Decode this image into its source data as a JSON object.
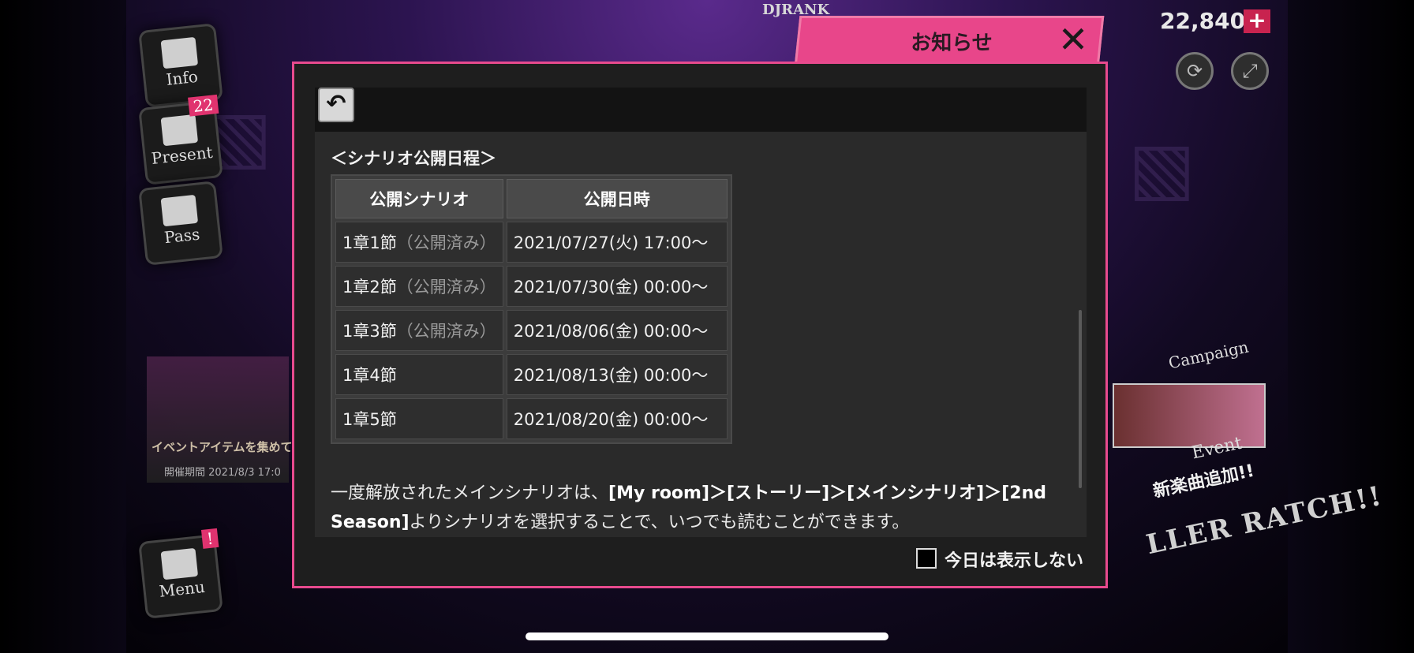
{
  "background": {
    "djrank_label": "DJRANK",
    "currency_amount": "22,840",
    "side_buttons": [
      {
        "label": "Info"
      },
      {
        "label": "Present",
        "badge": "22"
      },
      {
        "label": "Pass"
      },
      {
        "label": "Menu",
        "badge": "!"
      }
    ],
    "left_banner": {
      "text": "イベントアイテムを集めて",
      "period": "開催期間 2021/8/3 17:0"
    },
    "right_banner": {
      "campaign_label": "Campaign",
      "event_label": "Event",
      "new_song": "新楽曲追加!!",
      "scratch": "LLER RATCH!!"
    }
  },
  "modal": {
    "title": "お知らせ",
    "close_icon": "close-icon",
    "back_icon": "back-arrow-icon",
    "section_title": "＜シナリオ公開日程＞",
    "table": {
      "headers": [
        "公開シナリオ",
        "公開日時"
      ],
      "rows": [
        {
          "chapter": "1章1節",
          "status": "（公開済み）",
          "date": "2021/07/27(火) 17:00〜"
        },
        {
          "chapter": "1章2節",
          "status": "（公開済み）",
          "date": "2021/07/30(金) 00:00〜"
        },
        {
          "chapter": "1章3節",
          "status": "（公開済み）",
          "date": "2021/08/06(金) 00:00〜"
        },
        {
          "chapter": "1章4節",
          "status": "",
          "date": "2021/08/13(金) 00:00〜"
        },
        {
          "chapter": "1章5節",
          "status": "",
          "date": "2021/08/20(金) 00:00〜"
        }
      ]
    },
    "notice": {
      "prefix": "一度解放されたメインシナリオは、",
      "path": "[My room]＞[ストーリー]＞[メインシナリオ]＞[2nd Season]",
      "suffix": "よりシナリオを選択することで、いつでも読むことができます。"
    },
    "checkbox_label": "今日は表示しない",
    "checkbox_checked": false,
    "colors": {
      "accent": "#e8468a",
      "panel": "#2a2a2a"
    }
  }
}
